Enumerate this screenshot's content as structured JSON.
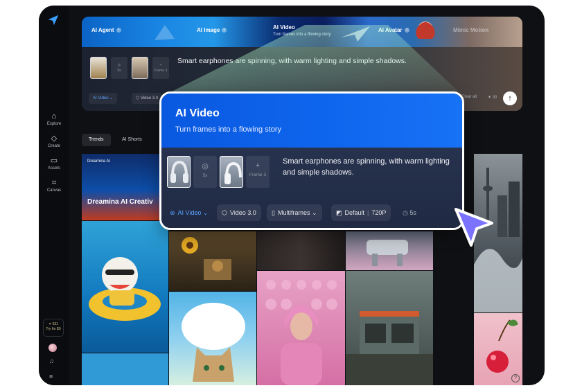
{
  "sidebar": {
    "items": [
      {
        "label": "Explore",
        "icon": "home-icon"
      },
      {
        "label": "Create",
        "icon": "diamond-icon"
      },
      {
        "label": "Assets",
        "icon": "folder-icon"
      },
      {
        "label": "Canvas",
        "icon": "canvas-icon"
      }
    ],
    "promo": {
      "line1": "✦ 631",
      "line2": "Try for $0"
    }
  },
  "hero": {
    "tabs": [
      {
        "label": "AI Agent"
      },
      {
        "label": "AI Image"
      },
      {
        "label": "AI Video",
        "sub": "Turn frames into a flowing story"
      },
      {
        "label": "AI Avatar"
      },
      {
        "label": "Mimic Motion"
      }
    ],
    "slot_duration": "5s",
    "slot_frame": "Frame 3",
    "prompt": "Smart earphones are spinning, with warm lighting and simple shadows.",
    "chips": [
      "AI Video",
      "Video 3.0"
    ],
    "clear": "Clear all",
    "credits": "✦ 30"
  },
  "filters": [
    {
      "label": "Trends",
      "active": true
    },
    {
      "label": "AI Shorts",
      "active": false
    }
  ],
  "banner": {
    "brand": "Dreamina AI",
    "headline": "Dreamina AI Creativ"
  },
  "popup": {
    "title": "AI Video",
    "subtitle": "Turn frames into a flowing story",
    "slot_duration": "5s",
    "slot_frame": "Frame 3",
    "prompt": "Smart earphones are spinning, with warm lighting and simple shadows.",
    "mode": "AI Video",
    "model": "Video 3.0",
    "frames": "Multiframes",
    "ratio": "Default",
    "resolution": "720P",
    "duration": "5s"
  },
  "colors": {
    "accent": "#0f67ef",
    "link": "#5aa2ff",
    "cursor": "#7b73ff"
  }
}
